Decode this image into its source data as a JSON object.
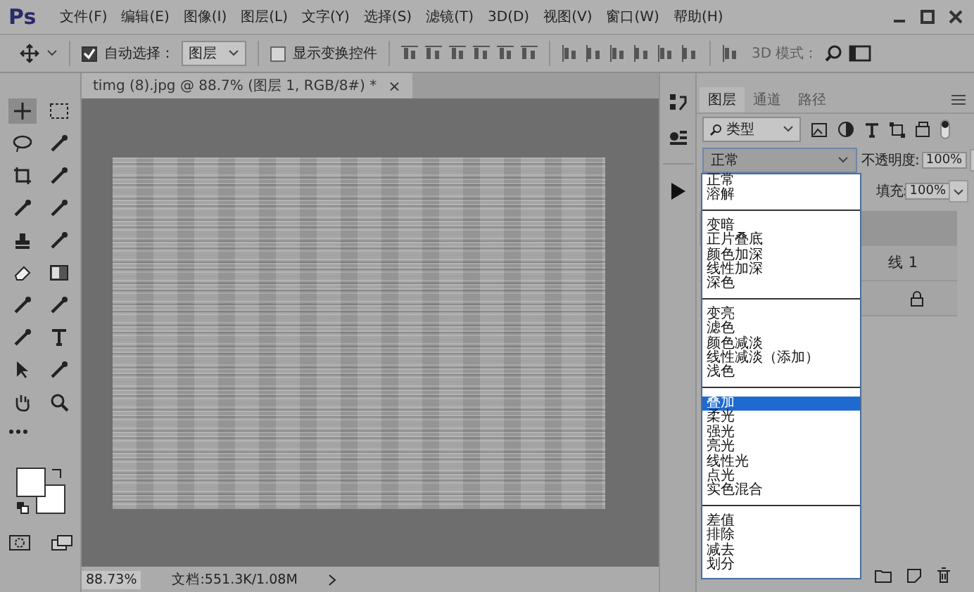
{
  "app": {
    "logo": "Ps"
  },
  "menu": [
    "文件(F)",
    "编辑(E)",
    "图像(I)",
    "图层(L)",
    "文字(Y)",
    "选择(S)",
    "滤镜(T)",
    "3D(D)",
    "视图(V)",
    "窗口(W)",
    "帮助(H)"
  ],
  "options_bar": {
    "auto_select": {
      "label": "自动选择：",
      "checked": true
    },
    "target": "图层",
    "show_transform": {
      "label": "显示变换控件",
      "checked": false
    },
    "mode_3d": {
      "label": "3D 模式：",
      "disabled": true
    }
  },
  "document": {
    "tab": {
      "title": "timg (8).jpg @ 88.7% (图层 1, RGB/8#) *",
      "close": "×"
    },
    "status": {
      "zoom": "88.73%",
      "info": "文档:551.3K/1.08M"
    }
  },
  "layers_panel": {
    "tabs": [
      {
        "label": "图层",
        "selected": true
      },
      {
        "label": "通道",
        "selected": false
      },
      {
        "label": "路径",
        "selected": false
      }
    ],
    "filter": "类型",
    "blend_mode": "正常",
    "opacity": {
      "label": "不透明度:",
      "value": "100%"
    },
    "fill": {
      "label": "填充:",
      "value": "100%"
    },
    "layers": [
      {
        "selected": true,
        "locked": false
      },
      {
        "name": "线 1",
        "selected": false,
        "locked": false
      },
      {
        "selected": false,
        "locked": true
      }
    ]
  },
  "blend_dropdown": {
    "groups": [
      {
        "items": [
          {
            "label": "正常",
            "selected": false
          },
          {
            "label": "溶解",
            "selected": false
          }
        ]
      },
      {
        "items": [
          {
            "label": "变暗",
            "selected": false
          },
          {
            "label": "正片叠底",
            "selected": false
          },
          {
            "label": "颜色加深",
            "selected": false
          },
          {
            "label": "线性加深",
            "selected": false
          },
          {
            "label": "深色",
            "selected": false
          }
        ]
      },
      {
        "items": [
          {
            "label": "变亮",
            "selected": false
          },
          {
            "label": "滤色",
            "selected": false
          },
          {
            "label": "颜色减淡",
            "selected": false
          },
          {
            "label": "线性减淡（添加）",
            "selected": false
          },
          {
            "label": "浅色",
            "selected": false
          }
        ]
      },
      {
        "items": [
          {
            "label": "叠加",
            "selected": true
          },
          {
            "label": "柔光",
            "selected": false
          },
          {
            "label": "强光",
            "selected": false
          },
          {
            "label": "亮光",
            "selected": false
          },
          {
            "label": "线性光",
            "selected": false
          },
          {
            "label": "点光",
            "selected": false
          },
          {
            "label": "实色混合",
            "selected": false
          }
        ]
      },
      {
        "items": [
          {
            "label": "差值",
            "selected": false
          },
          {
            "label": "排除",
            "selected": false
          },
          {
            "label": "减去",
            "selected": false
          },
          {
            "label": "划分",
            "selected": false
          }
        ]
      }
    ]
  }
}
